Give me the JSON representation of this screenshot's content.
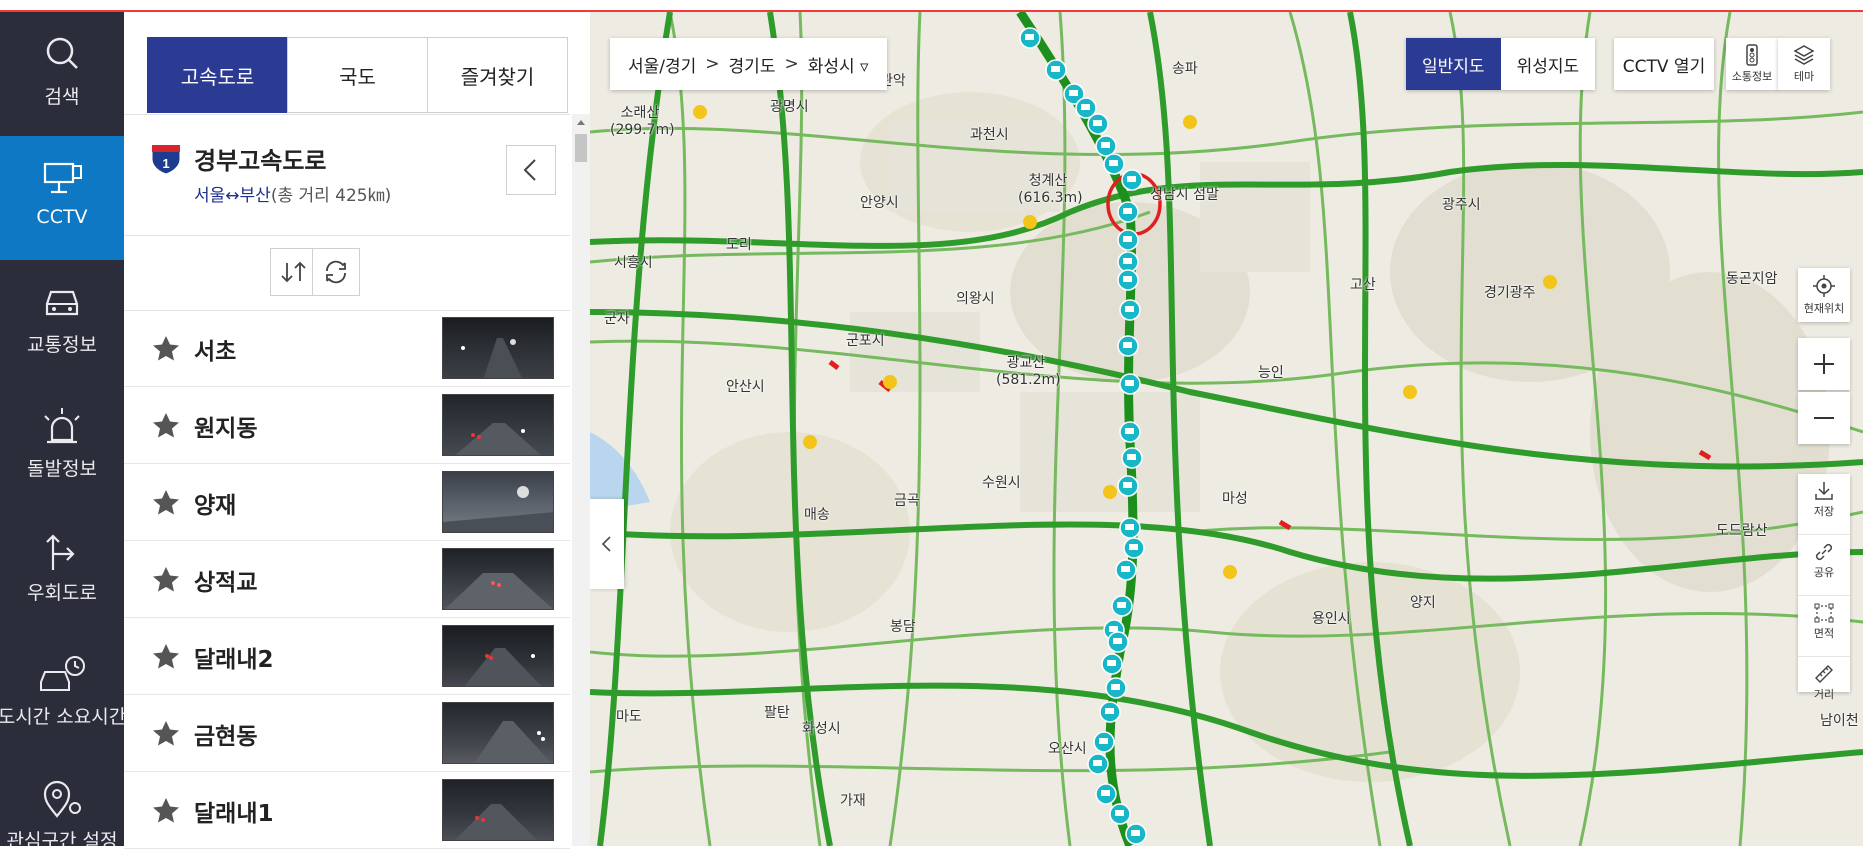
{
  "nav": {
    "items": [
      {
        "label": "검색",
        "icon": "search-icon"
      },
      {
        "label": "CCTV",
        "icon": "cctv-icon",
        "active": true
      },
      {
        "label": "교통정보",
        "icon": "car-icon"
      },
      {
        "label": "돌발정보",
        "icon": "siren-icon"
      },
      {
        "label": "우회도로",
        "icon": "detour-icon"
      },
      {
        "label": "도시간 소요시간",
        "icon": "travel-time-icon"
      },
      {
        "label": "관심구간 설정",
        "icon": "location-pin-icon"
      }
    ]
  },
  "panel": {
    "tabs": [
      {
        "label": "고속도로",
        "active": true
      },
      {
        "label": "국도"
      },
      {
        "label": "즐겨찾기"
      }
    ],
    "highway": {
      "number": "1",
      "title": "경부고속도로",
      "route": "서울↔부산",
      "distance": "(총 거리 425㎞)"
    },
    "cctv_list": [
      {
        "name": "서초"
      },
      {
        "name": "원지동"
      },
      {
        "name": "양재"
      },
      {
        "name": "상적교"
      },
      {
        "name": "달래내2"
      },
      {
        "name": "금현동"
      },
      {
        "name": "달래내1"
      }
    ]
  },
  "map": {
    "breadcrumb": [
      "서울/경기",
      "경기도",
      "화성시 ▿"
    ],
    "map_types": [
      {
        "label": "일반지도",
        "active": true
      },
      {
        "label": "위성지도"
      }
    ],
    "cctv_open_label": "CCTV 열기",
    "top_tools": [
      {
        "label": "소통정보",
        "icon": "traffic-light-icon"
      },
      {
        "label": "테마",
        "icon": "layers-icon"
      }
    ],
    "current_location_label": "현재위치",
    "side_tools": [
      {
        "label": "저장",
        "icon": "download-icon"
      },
      {
        "label": "공유",
        "icon": "link-icon"
      },
      {
        "label": "면적",
        "icon": "area-icon"
      },
      {
        "label": "거리",
        "icon": "ruler-icon"
      }
    ],
    "labels": [
      {
        "text": "과천시"
      },
      {
        "text": "안양시"
      },
      {
        "text": "시흥시"
      },
      {
        "text": "의왕시"
      },
      {
        "text": "군포시"
      },
      {
        "text": "안산시"
      },
      {
        "text": "수원시"
      },
      {
        "text": "화성시"
      },
      {
        "text": "오산시"
      },
      {
        "text": "용인시"
      },
      {
        "text": "광주시"
      },
      {
        "text": "성남시 섬말"
      },
      {
        "text": "청계산 (616.3m)"
      },
      {
        "text": "광교산 (581.2m)"
      },
      {
        "text": "소래산 (299.7m)"
      },
      {
        "text": "광명시"
      },
      {
        "text": "송파"
      },
      {
        "text": "마성"
      },
      {
        "text": "능인"
      },
      {
        "text": "고산"
      },
      {
        "text": "양지"
      },
      {
        "text": "봉담"
      },
      {
        "text": "매송"
      },
      {
        "text": "금곡"
      },
      {
        "text": "팔탄"
      },
      {
        "text": "마도"
      },
      {
        "text": "군자"
      },
      {
        "text": "도리"
      },
      {
        "text": "관악"
      },
      {
        "text": "경기광주"
      },
      {
        "text": "동곤지암"
      },
      {
        "text": "도드람산"
      },
      {
        "text": "남이천"
      },
      {
        "text": "가재"
      }
    ]
  },
  "colors": {
    "accent": "#2b3a93",
    "nav_bg": "#2b2d3a",
    "nav_active": "#0f78c4",
    "road": "#3fa535",
    "cctv_marker": "#18b7c8"
  }
}
